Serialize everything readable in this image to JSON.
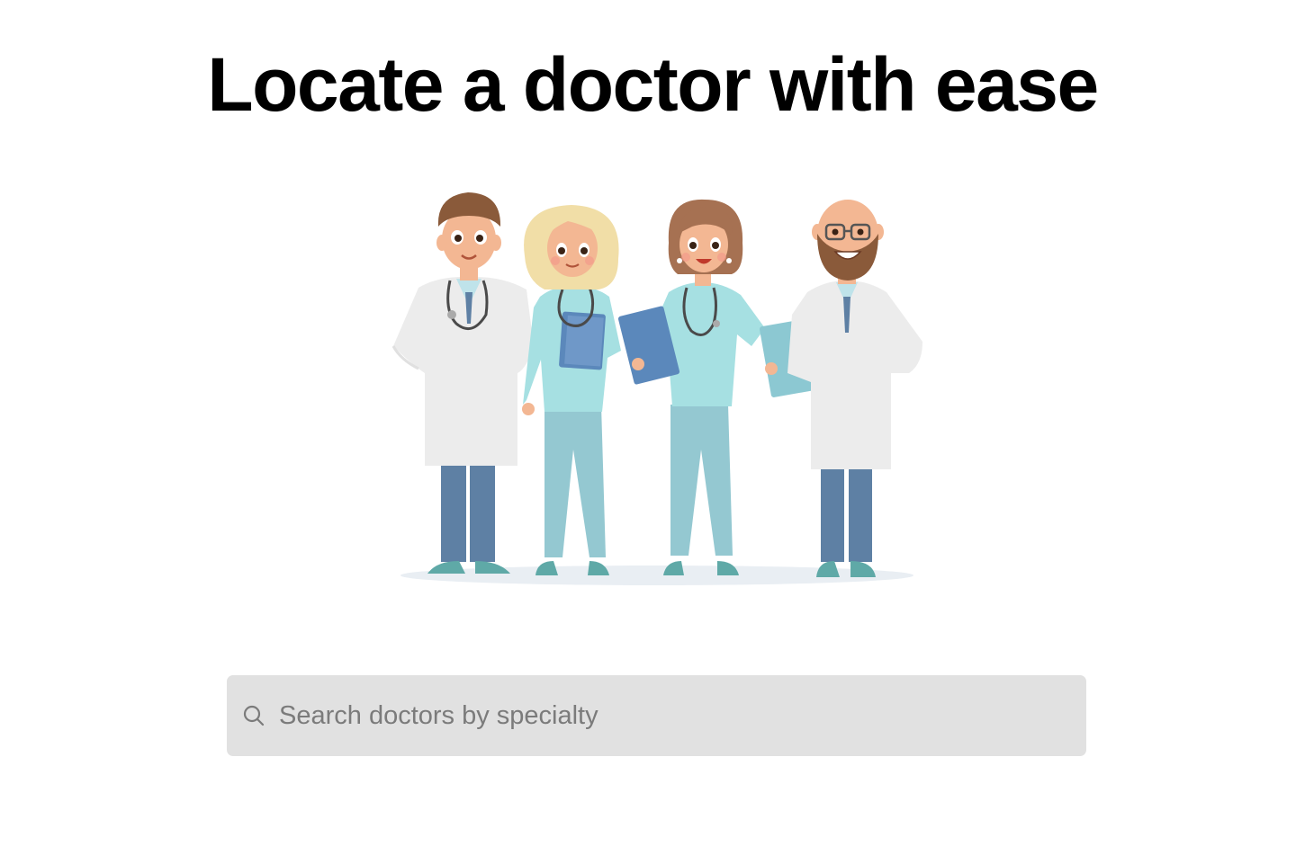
{
  "hero": {
    "headline": "Locate a doctor with ease"
  },
  "illustration": {
    "description_icon": "doctors-group-illustration"
  },
  "search": {
    "placeholder": "Search doctors by specialty",
    "value": "",
    "icon": "search-icon"
  },
  "colors": {
    "background": "#ffffff",
    "headline": "#000000",
    "search_bg": "#e1e1e1",
    "placeholder": "#7b7b7b",
    "scrubs": "#a6e0e2",
    "scrub_pants": "#94c8d1",
    "coat": "#ececec",
    "pants": "#5e80a4",
    "folder": "#5b88bb"
  }
}
